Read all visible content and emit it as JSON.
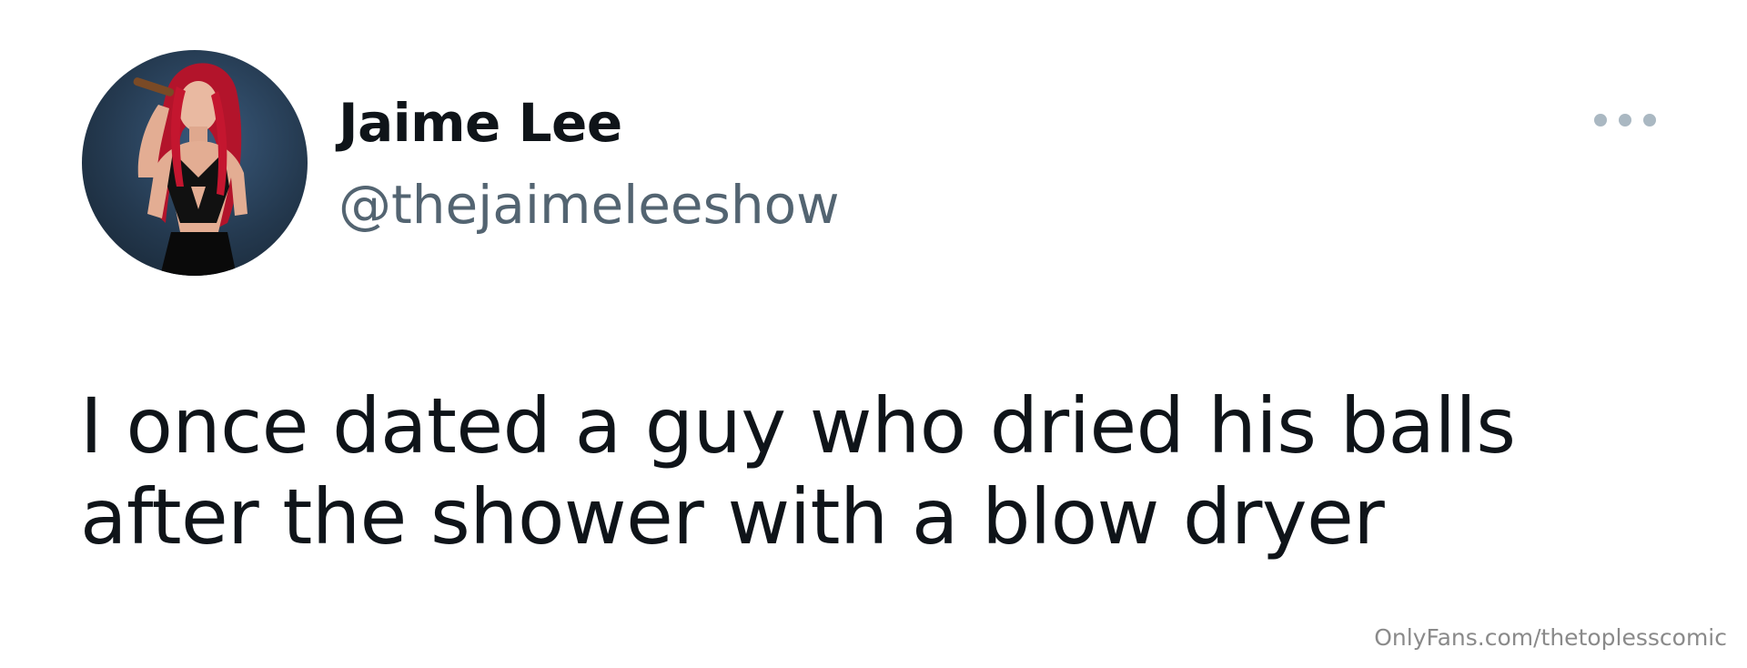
{
  "tweet": {
    "author": {
      "display_name": "Jaime Lee",
      "handle": "@thejaimeleeshow",
      "avatar": "profile-photo-woman-red-hair"
    },
    "more_icon": "more-horizontal-icon",
    "text_lines": [
      "I once dated a guy who dried his balls",
      "after the shower with a blow dryer"
    ]
  },
  "watermark": "OnlyFans.com/thetoplesscomic",
  "colors": {
    "name": "#0f1419",
    "handle": "#536471",
    "more_dots": "#aab8c2",
    "watermark": "#8a8a8a",
    "background": "#ffffff"
  }
}
